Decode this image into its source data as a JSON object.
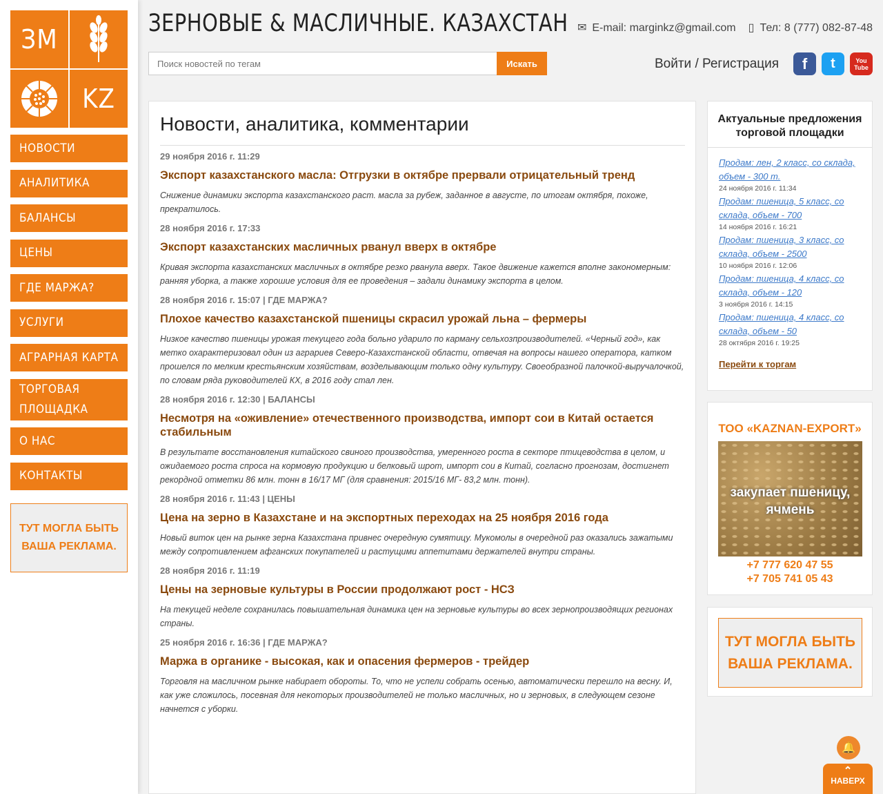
{
  "logo": {
    "tl": "ЗМ",
    "br": "KZ"
  },
  "nav": [
    {
      "label": "НОВОСТИ"
    },
    {
      "label": "АНАЛИТИКА"
    },
    {
      "label": "БАЛАНСЫ"
    },
    {
      "label": "ЦЕНЫ"
    },
    {
      "label": "ГДЕ МАРЖА?"
    },
    {
      "label": "УСЛУГИ"
    },
    {
      "label": "АГРАРНАЯ КАРТА"
    },
    {
      "label": "ТОРГОВАЯ ПЛОЩАДКА"
    },
    {
      "label": "О НАС"
    },
    {
      "label": "КОНТАКТЫ"
    }
  ],
  "left_ad": {
    "line1": "ТУТ МОГЛА БЫТЬ",
    "line2": "ВАША РЕКЛАМА."
  },
  "header": {
    "site_title": "ЗЕРНОВЫЕ & МАСЛИЧНЫЕ. КАЗАХСТАН",
    "email": "E-mail: marginkz@gmail.com",
    "phone": "Тел: 8 (777) 082-87-48",
    "search_placeholder": "Поиск новостей по тегам",
    "search_button": "Искать",
    "login": "Войти / Регистрация"
  },
  "social": [
    {
      "icon": "facebook-icon",
      "glyph": "f",
      "color": "#3b5998"
    },
    {
      "icon": "twitter-icon",
      "glyph": "t",
      "color": "#1da1f2"
    },
    {
      "icon": "youtube-icon",
      "glyph": "You Tube",
      "color": "#d62a1e"
    }
  ],
  "main": {
    "heading": "Новости, аналитика, комментарии",
    "articles": [
      {
        "date": "29 ноября 2016 г. 11:29",
        "category": "",
        "title": "Экспорт казахстанского масла: Отгрузки в октябре прервали отрицательный тренд",
        "desc": "Снижение динамики экспорта казахстанского раст. масла за рубеж, заданное в августе, по итогам октября, похоже, прекратилось."
      },
      {
        "date": "28 ноября 2016 г. 17:33",
        "category": "",
        "title": "Экспорт казахстанских масличных рванул вверх в октябре",
        "desc": "Кривая экспорта казахстанских масличных в октябре резко рванула вверх. Такое движение кажется вполне закономерным: ранняя уборка, а также хорошие условия для ее проведения – задали динамику экспорта в целом."
      },
      {
        "date": "28 ноября 2016 г. 15:07",
        "category": "| ГДЕ МАРЖА?",
        "title": "Плохое качество казахстанской пшеницы скрасил урожай льна – фермеры",
        "desc": "Низкое качество пшеницы урожая текущего года больно ударило по карману сельхозпроизводителей. «Черный год», как метко охарактеризовал один из аграриев Северо-Казахстанской области, отвечая на вопросы нашего оператора, катком прошелся по мелким крестьянским хозяйствам, возделывающим только одну культуру. Своеобразной палочкой-выручалочкой, по словам ряда руководителей КХ, в 2016 году стал лен."
      },
      {
        "date": "28 ноября 2016 г. 12:30",
        "category": "| БАЛАНСЫ",
        "title": "Несмотря на «оживление» отечественного производства, импорт сои в Китай остается  стабильным",
        "desc": "В результате восстановления китайского свиного производства, умеренного роста в секторе птицеводства в целом, и ожидаемого роста спроса на кормовую продукцию и белковый шрот, импорт сои в Китай, согласно прогнозам, достигнет рекордной отметки 86 млн. тонн  в 16/17 МГ (для сравнения: 2015/16 МГ- 83,2 млн. тонн)."
      },
      {
        "date": "28 ноября 2016 г. 11:43",
        "category": "| ЦЕНЫ",
        "title": "Цена на зерно в Казахстане и на экспортных переходах на 25 ноября 2016 года",
        "desc": "Новый виток цен на рынке зерна Казахстана привнес очередную сумятицу. Мукомолы в очередной раз оказались зажатыми между сопротивлением афганских покупателей и растущими аппетитами держателей внутри страны."
      },
      {
        "date": "28 ноября 2016 г. 11:19",
        "category": "",
        "title": "Цены на зерновые культуры в России продолжают рост - НСЗ",
        "desc": "На текущей неделе сохранилась повышательная динамика цен на зерновые культуры во всех зернопроизводящих регионах страны."
      },
      {
        "date": "25 ноября 2016 г. 16:36",
        "category": "| ГДЕ МАРЖА?",
        "title": "Маржа в органике - высокая, как и опасения фермеров - трейдер",
        "desc": "Торговля на масличном рынке набирает обороты. То, что не успели собрать осенью, автоматически перешло на весну. И, как уже сложилось, посевная для некоторых производителей не только масличных, но и зерновых, в следующем сезоне начнется с уборки."
      }
    ]
  },
  "offers": {
    "heading": "Актуальные предложения торговой площадки",
    "items": [
      {
        "text": "Продам: лен, 2 класс, со склада, объем - 300 т.",
        "date": "24 ноября 2016 г. 11:34"
      },
      {
        "text": "Продам: пшеница, 5 класс, со склада, объем - 700",
        "date": "14 ноября 2016 г. 16:21"
      },
      {
        "text": "Продам: пшеница, 3 класс, со склада, объем - 2500",
        "date": "10 ноября 2016 г. 12:06"
      },
      {
        "text": "Продам: пшеница, 4 класс, со склада, объем - 120",
        "date": "3 ноября 2016 г. 14:15"
      },
      {
        "text": "Продам: пшеница, 4 класс, со склада, объем - 50",
        "date": "28 октября 2016 г. 19:25"
      }
    ],
    "link": "Перейти к торгам"
  },
  "kaznan": {
    "title": "ТОО «KAZNAN-EXPORT»",
    "overlay": "закупает пшеницу, ячмень",
    "phone1": "+7 777 620 47 55",
    "phone2": "+7 705 741 05 43"
  },
  "right_ad": {
    "line1": "ТУТ МОГЛА БЫТЬ",
    "line2": "ВАША РЕКЛАМА."
  },
  "totop": {
    "label": "НАВЕРХ"
  },
  "colors": {
    "accent": "#ee7d17",
    "title": "#8a4a0f",
    "link": "#3c79c9"
  }
}
